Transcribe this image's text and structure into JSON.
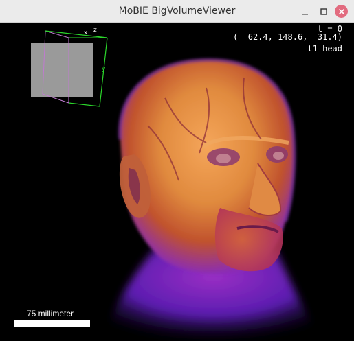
{
  "window": {
    "title": "MoBIE BigVolumeViewer",
    "controls": [
      "minimize-icon",
      "maximize-icon",
      "close-icon"
    ]
  },
  "overlay": {
    "timepoint": "t = 0",
    "coordinates": "(  62.4, 148.6,  31.4)",
    "source_name": "t1-head"
  },
  "box_axes": {
    "x": "x",
    "y": "y",
    "z": "z"
  },
  "scale_bar": {
    "label": "75 millimeter"
  },
  "colors": {
    "titlebar": "#ebebeb",
    "close_button": "#e26b7f",
    "background": "#000000",
    "box_green": "#2bd62b",
    "box_magenta": "#c07ad0"
  }
}
